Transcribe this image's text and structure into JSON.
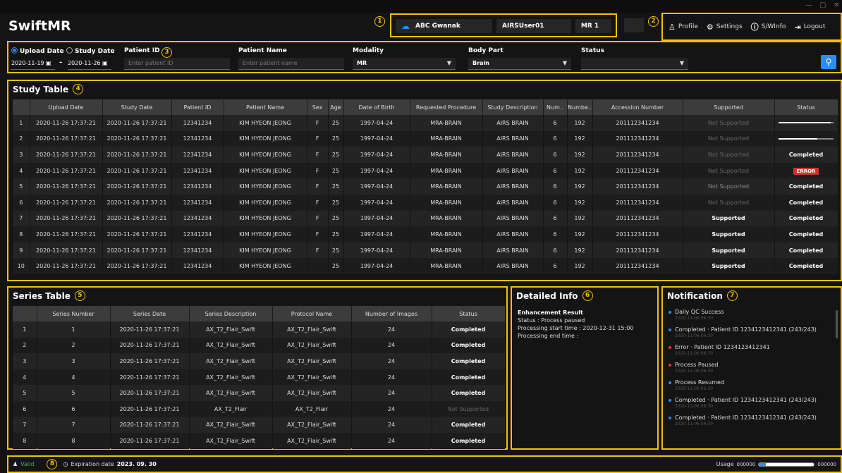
{
  "app": {
    "title": "SwiftMR"
  },
  "markers": [
    "1",
    "2",
    "3",
    "4",
    "5",
    "6",
    "7",
    "8"
  ],
  "site": {
    "hospital": "ABC Gwanak",
    "user": "AIRSUser01",
    "device": "MR 1"
  },
  "topnav": [
    {
      "label": "Profile",
      "icon": "person-icon"
    },
    {
      "label": "Settings",
      "icon": "gear-icon"
    },
    {
      "label": "S/WInfo",
      "icon": "info-icon"
    },
    {
      "label": "Logout",
      "icon": "logout-icon"
    }
  ],
  "search": {
    "upload_date_label": "Upload Date",
    "study_date_label": "Study Date",
    "date_from": "2020-11-19",
    "date_sep": "–",
    "date_to": "2020-11-26",
    "patient_id_label": "Patient ID",
    "patient_id_placeholder": "Enter patient ID",
    "patient_name_label": "Patient Name",
    "patient_name_placeholder": "Enter patient name",
    "modality_label": "Modality",
    "modality_value": "MR",
    "body_part_label": "Body Part",
    "body_part_value": "Brain",
    "status_label": "Status",
    "status_value": ""
  },
  "study": {
    "title": "Study Table",
    "columns": [
      "",
      "Upload Date",
      "Study Date",
      "Patient ID",
      "Patient Name",
      "Sex",
      "Age",
      "Date of Birth",
      "Requested Procedure",
      "Study Description",
      "Num..",
      "Numbe..",
      "Accession Number",
      "Supported",
      "Status"
    ],
    "rows": [
      [
        "1",
        "2020-11-26 17:37:21",
        "2020-11-26 17:37:21",
        "12341234",
        "KIM HYEON JEONG",
        "F",
        "25",
        "1997-04-24",
        "MRA-BRAIN",
        "AIRS BRAIN",
        "6",
        "192",
        "201112341234",
        "Not Supported",
        ""
      ],
      [
        "2",
        "2020-11-26 17:37:21",
        "2020-11-26 17:37:21",
        "12341234",
        "KIM HYEON JEONG",
        "F",
        "25",
        "1997-04-24",
        "MRA-BRAIN",
        "AIRS BRAIN",
        "6",
        "192",
        "201112341234",
        "Not Supported",
        ""
      ],
      [
        "3",
        "2020-11-26 17:37:21",
        "2020-11-26 17:37:21",
        "12341234",
        "KIM HYEON JEONG",
        "F",
        "25",
        "1997-04-24",
        "MRA-BRAIN",
        "AIRS BRAIN",
        "6",
        "192",
        "201112341234",
        "Not Supported",
        "Completed"
      ],
      [
        "4",
        "2020-11-26 17:37:21",
        "2020-11-26 17:37:21",
        "12341234",
        "KIM HYEON JEONG",
        "F",
        "25",
        "1997-04-24",
        "MRA-BRAIN",
        "AIRS BRAIN",
        "6",
        "192",
        "201112341234",
        "Not Supported",
        "ERROR"
      ],
      [
        "5",
        "2020-11-26 17:37:21",
        "2020-11-26 17:37:21",
        "12341234",
        "KIM HYEON JEONG",
        "F",
        "25",
        "1997-04-24",
        "MRA-BRAIN",
        "AIRS BRAIN",
        "6",
        "192",
        "201112341234",
        "Not Supported",
        "Completed"
      ],
      [
        "6",
        "2020-11-26 17:37:21",
        "2020-11-26 17:37:21",
        "12341234",
        "KIM HYEON JEONG",
        "F",
        "25",
        "1997-04-24",
        "MRA-BRAIN",
        "AIRS BRAIN",
        "6",
        "192",
        "201112341234",
        "Not Supported",
        "Completed"
      ],
      [
        "7",
        "2020-11-26 17:37:21",
        "2020-11-26 17:37:21",
        "12341234",
        "KIM HYEON JEONG",
        "F",
        "25",
        "1997-04-24",
        "MRA-BRAIN",
        "AIRS BRAIN",
        "6",
        "192",
        "201112341234",
        "Supported",
        "Completed"
      ],
      [
        "8",
        "2020-11-26 17:37:21",
        "2020-11-26 17:37:21",
        "12341234",
        "KIM HYEON JEONG",
        "F",
        "25",
        "1997-04-24",
        "MRA-BRAIN",
        "AIRS BRAIN",
        "6",
        "192",
        "201112341234",
        "Supported",
        "Completed"
      ],
      [
        "9",
        "2020-11-26 17:37:21",
        "2020-11-26 17:37:21",
        "12341234",
        "KIM HYEON JEONG",
        "F",
        "25",
        "1997-04-24",
        "MRA-BRAIN",
        "AIRS BRAIN",
        "6",
        "192",
        "201112341234",
        "Supported",
        "Completed"
      ],
      [
        "10",
        "2020-11-26 17:37:21",
        "2020-11-26 17:37:21",
        "12341234",
        "KIM HYEON JEONG",
        "",
        "25",
        "1997-04-24",
        "MRA-BRAIN",
        "AIRS BRAIN",
        "6",
        "192",
        "201112341234",
        "Supported",
        "Completed"
      ]
    ],
    "progress": [
      0.95,
      0.7
    ]
  },
  "series": {
    "title": "Series Table",
    "columns": [
      "",
      "Series Number",
      "Series Date",
      "Series Description",
      "Protocol Name",
      "Number of Images",
      "Status"
    ],
    "rows": [
      [
        "1",
        "1",
        "2020-11-26 17:37:21",
        "AX_T2_Flair_Swift",
        "AX_T2_Flair_Swift",
        "24",
        "Completed"
      ],
      [
        "2",
        "2",
        "2020-11-26 17:37:21",
        "AX_T2_Flair_Swift",
        "AX_T2_Flair_Swift",
        "24",
        "Completed"
      ],
      [
        "3",
        "3",
        "2020-11-26 17:37:21",
        "AX_T2_Flair_Swift",
        "AX_T2_Flair_Swift",
        "24",
        "Completed"
      ],
      [
        "4",
        "4",
        "2020-11-26 17:37:21",
        "AX_T2_Flair_Swift",
        "AX_T2_Flair_Swift",
        "24",
        "Completed"
      ],
      [
        "5",
        "5",
        "2020-11-26 17:37:21",
        "AX_T2_Flair_Swift",
        "AX_T2_Flair_Swift",
        "24",
        "Completed"
      ],
      [
        "6",
        "6",
        "2020-11-26 17:37:21",
        "AX_T2_Flair",
        "AX_T2_Flair",
        "24",
        "Not Supported"
      ],
      [
        "7",
        "7",
        "2020-11-26 17:37:21",
        "AX_T2_Flair_Swift",
        "AX_T2_Flair_Swift",
        "24",
        "Completed"
      ],
      [
        "8",
        "8",
        "2020-11-26 17:37:21",
        "AX_T2_Flair_Swift",
        "AX_T2_Flair_Swift",
        "24",
        "Completed"
      ]
    ]
  },
  "detail": {
    "title": "Detailed Info",
    "heading": "Enhancement Result",
    "lines": [
      "Status : Process paused",
      "Processing start time : 2020-12-31 15:00",
      "Processing end time :"
    ]
  },
  "notification": {
    "title": "Notification",
    "items": [
      {
        "text": "Daily QC Success",
        "date": "2020-11-06 06:30",
        "color": "#2e8bf2"
      },
      {
        "text": "Completed · Patient ID 1234123412341 (243/243)",
        "date": "2020-11-06 06:30",
        "color": "#2e8bf2"
      },
      {
        "text": "Error · Patient ID 1234123412341",
        "date": "2020-11-06 06:30",
        "color": "#e53935"
      },
      {
        "text": "Process Paused",
        "date": "2020-11-06 06:30",
        "color": "#e53935"
      },
      {
        "text": "Process Resumed",
        "date": "2020-11-06 06:30",
        "color": "#2e8bf2"
      },
      {
        "text": "Completed · Patient ID 1234123412341 (243/243)",
        "date": "2020-11-06 06:30",
        "color": "#2e8bf2"
      },
      {
        "text": "Completed · Patient ID 1234123412341 (243/243)",
        "date": "2020-11-06 06:30",
        "color": "#2e8bf2"
      }
    ]
  },
  "footer": {
    "license_status": "Valid",
    "expiration_label": "Expiration date",
    "expiration_value": "2023. 09. 30",
    "usage_label": "Usage",
    "usage_min": "000000",
    "usage_max": "000000",
    "usage_fraction": 0.12
  },
  "colors": {
    "accent": "#f2c200",
    "primary": "#2e8bf2",
    "error": "#d32f2f",
    "valid": "#4caf50"
  }
}
